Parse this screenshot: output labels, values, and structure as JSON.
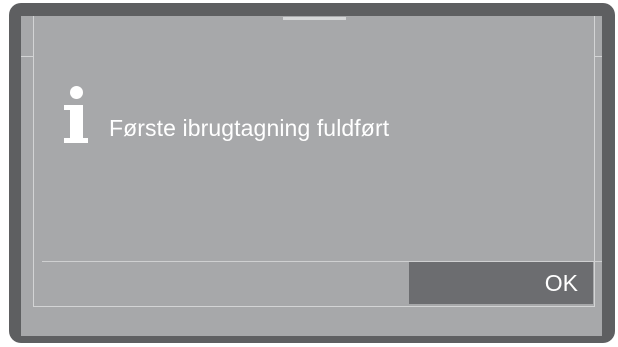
{
  "dialog": {
    "icon": "info-icon",
    "message": "Første ibrugtagning fuldført",
    "ok_label": "OK"
  },
  "colors": {
    "frame": "#5e5f61",
    "screen": "#a7a8aa",
    "button": "#6c6d70",
    "text": "#ffffff"
  }
}
